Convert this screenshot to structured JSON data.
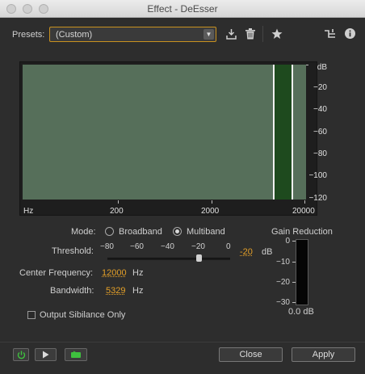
{
  "window": {
    "title": "Effect - DeEsser"
  },
  "presets": {
    "label": "Presets:",
    "selected": "(Custom)"
  },
  "graph": {
    "y_unit": "dB",
    "y_ticks": [
      "−20",
      "−40",
      "−60",
      "−80",
      "−100",
      "−120"
    ],
    "x_unit": "Hz",
    "x_ticks": [
      "200",
      "2000",
      "20000"
    ]
  },
  "mode": {
    "label": "Mode:",
    "options": [
      "Broadband",
      "Multiband"
    ],
    "selected": "Multiband"
  },
  "threshold": {
    "label": "Threshold:",
    "scale": [
      "−80",
      "−60",
      "−40",
      "−20",
      "0"
    ],
    "value": "-20",
    "unit": "dB"
  },
  "center_frequency": {
    "label": "Center Frequency:",
    "value": "12000",
    "unit": "Hz"
  },
  "bandwidth": {
    "label": "Bandwidth:",
    "value": "5329",
    "unit": "Hz"
  },
  "output_sibilance": {
    "label": "Output Sibilance Only",
    "checked": false
  },
  "gain_reduction": {
    "title": "Gain Reduction",
    "ticks": [
      "0",
      "−10",
      "−20",
      "−30"
    ],
    "value": "0.0 dB"
  },
  "buttons": {
    "close": "Close",
    "apply": "Apply"
  }
}
